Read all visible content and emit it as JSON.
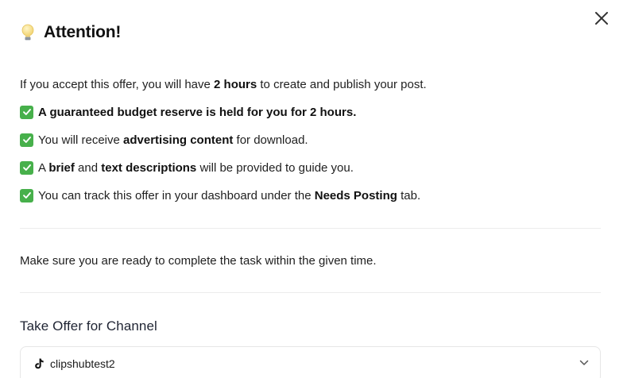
{
  "dialog": {
    "title": "Attention!",
    "close_icon": "close-icon",
    "title_icon": "lightbulb-icon"
  },
  "intro": {
    "part1": "If you accept this offer, you will have ",
    "bold1": "2 hours",
    "part2": " to create and publish your post."
  },
  "bullets": [
    {
      "bold": "A guaranteed budget reserve is held for you for 2 hours."
    },
    {
      "text1": "You will receive ",
      "bold1": "advertising content",
      "text2": " for download."
    },
    {
      "text1": "A ",
      "bold1": "brief",
      "text2": " and ",
      "bold2": "text descriptions",
      "text3": " will be provided to guide you."
    },
    {
      "text1": "You can track this offer in your dashboard under the ",
      "bold1": "Needs Posting",
      "text2": " tab."
    }
  ],
  "note": "Make sure you are ready to complete the task within the given time.",
  "channel": {
    "label": "Take Offer for Channel",
    "selected": "clipshubtest2",
    "platform_icon": "tiktok-icon",
    "dropdown_icon": "chevron-down-icon"
  },
  "colors": {
    "check_green": "#47b04b",
    "divider": "#ececec"
  }
}
